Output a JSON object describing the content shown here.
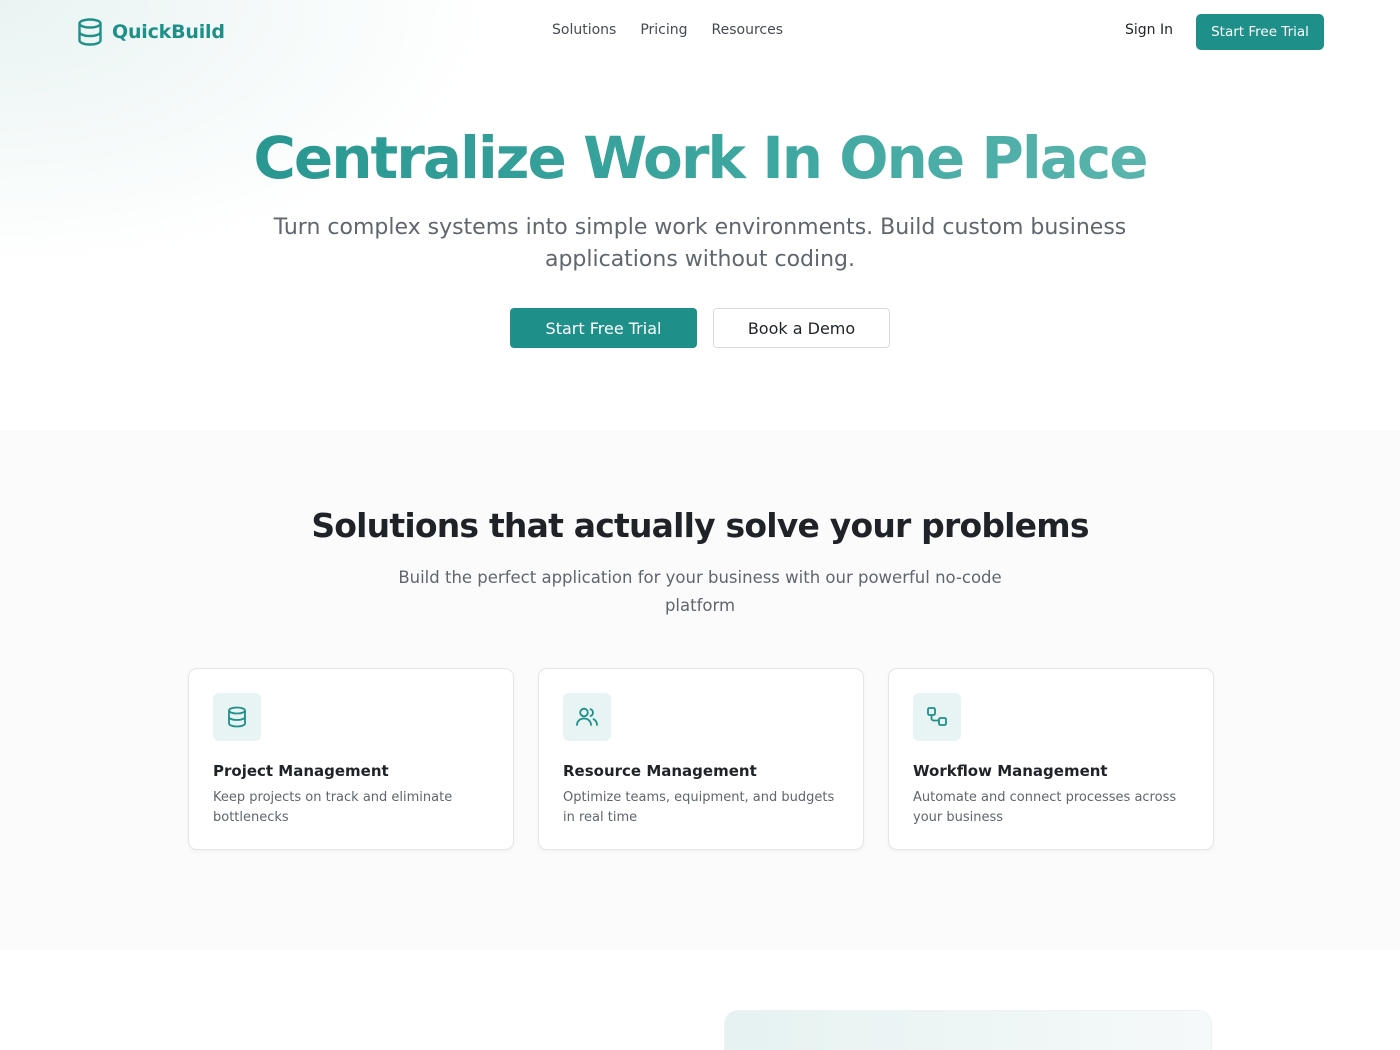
{
  "brand": {
    "name": "QuickBuild",
    "icon": "database-icon",
    "color": "#1f8f89"
  },
  "nav": {
    "links": [
      "Solutions",
      "Pricing",
      "Resources"
    ],
    "sign_in": "Sign In",
    "cta": "Start Free Trial"
  },
  "hero": {
    "title": "Centralize Work In One Place",
    "subtitle": "Turn complex systems into simple work environments. Build custom business applications without coding.",
    "primary_cta": "Start Free Trial",
    "secondary_cta": "Book a Demo"
  },
  "solutions": {
    "title": "Solutions that actually solve your problems",
    "subtitle": "Build the perfect application for your business with our powerful no-code platform",
    "cards": [
      {
        "icon": "database-icon",
        "title": "Project Management",
        "text": "Keep projects on track and eliminate bottlenecks"
      },
      {
        "icon": "users-icon",
        "title": "Resource Management",
        "text": "Optimize teams, equipment, and budgets in real time"
      },
      {
        "icon": "workflow-icon",
        "title": "Workflow Management",
        "text": "Automate and connect processes across your business"
      }
    ]
  },
  "colors": {
    "accent": "#1f8f89",
    "accent_light": "#e8f4f3",
    "text": "#1f2328",
    "muted": "#5f666d"
  }
}
